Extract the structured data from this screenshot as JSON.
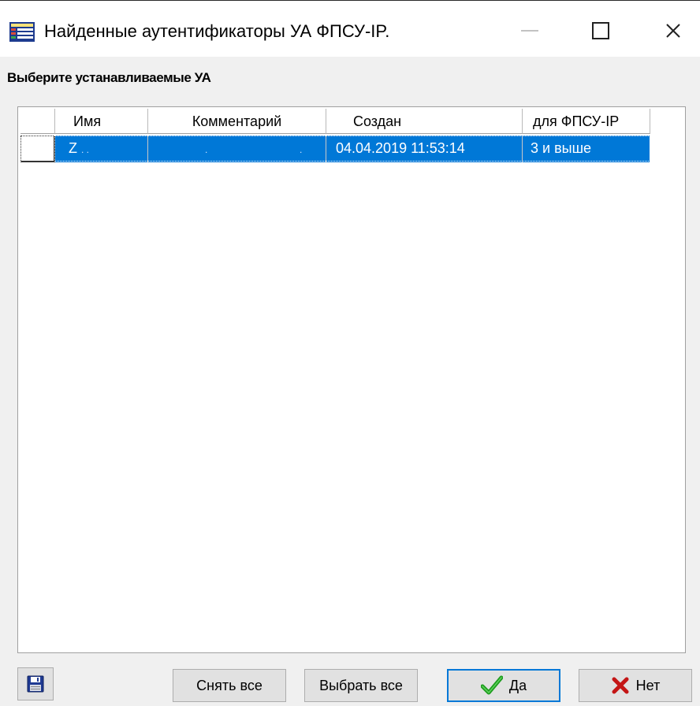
{
  "window": {
    "title": "Найденные аутентификаторы УА ФПСУ-IP.",
    "app_icon": "table-list-icon",
    "controls": [
      "minimize-icon",
      "maximize-icon",
      "close-icon"
    ],
    "close_glyph": "✕"
  },
  "section": {
    "label": "Выберите устанавливаемые УА"
  },
  "grid": {
    "columns": [
      "Имя",
      "Комментарий",
      "Создан",
      "для ФПСУ-IP"
    ],
    "rows": [
      {
        "checked": false,
        "name": "Z",
        "comment": "",
        "created": "04.04.2019 11:53:14",
        "fpsu": "3 и выше",
        "selected": true
      }
    ]
  },
  "buttons": {
    "save_icon": "floppy-disk-icon",
    "clear_all": "Снять все",
    "select_all": "Выбрать все",
    "yes": "Да",
    "no": "Нет"
  },
  "colors": {
    "selection": "#0078d7",
    "check_green": "#1e9c1e",
    "x_red": "#c41616"
  }
}
